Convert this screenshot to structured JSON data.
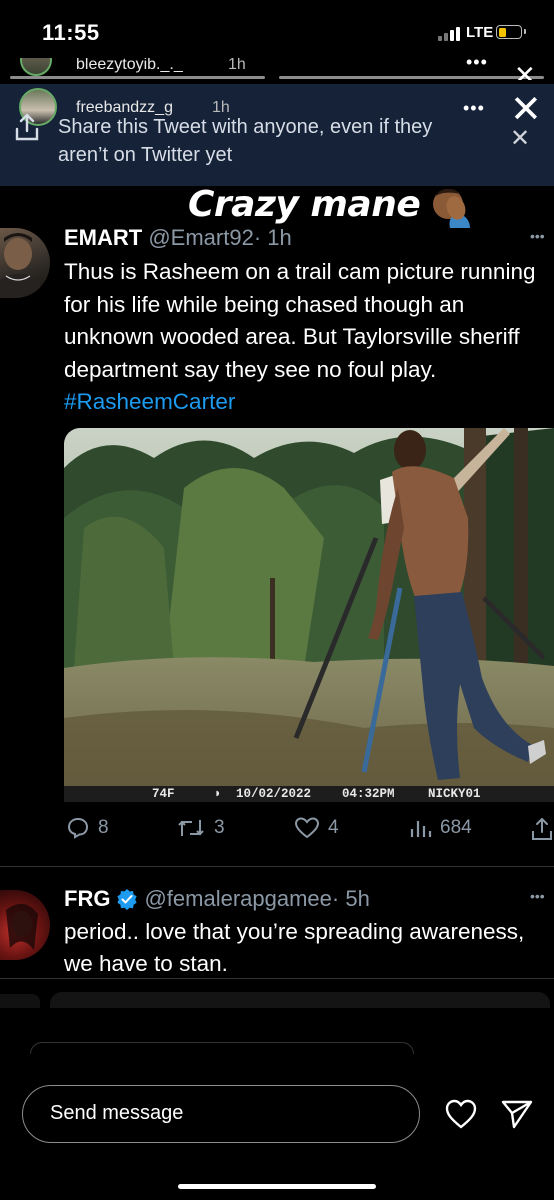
{
  "status_bar": {
    "time": "11:55",
    "network": "LTE"
  },
  "story_back": {
    "username": "bleezytoyib._._",
    "ago": "1h"
  },
  "story_front": {
    "username": "freebandzz_g",
    "ago": "1h"
  },
  "share_banner": {
    "text": "Share this Tweet with anyone, even if they aren’t on Twitter yet"
  },
  "overlay": {
    "caption": "Crazy mane",
    "emoji": "facepalm"
  },
  "tweet": {
    "name": "EMART",
    "handle": "@Emart92",
    "ago": "· 1h",
    "text": "Thus is Rasheem on a trail cam picture running for his life while being chased though an unknown wooded area. But Taylorsville sheriff department say they see no foul play. ",
    "hashtag": "#RasheemCarter",
    "cam_strip": {
      "temp": "74F",
      "date": "10/02/2022",
      "time": "04:32PM",
      "camera": "NICKY01"
    },
    "stats": {
      "replies": "8",
      "retweets": "3",
      "likes": "4",
      "views": "684"
    }
  },
  "reply": {
    "name": "FRG",
    "handle": "@femalerapgamee",
    "ago": "· 5h",
    "text": "period.. love that you’re spreading awareness, we have to stan."
  },
  "message_bar": {
    "placeholder": "Send message"
  },
  "icons": [
    "share-icon",
    "close-icon",
    "more-dots-icon",
    "reply-icon",
    "retweet-icon",
    "like-icon",
    "views-icon",
    "share-icon",
    "verified-badge-icon",
    "heart-icon",
    "send-icon"
  ],
  "colors": {
    "link": "#1d9bf0",
    "banner": "#152238",
    "muted": "#8b98a5"
  }
}
